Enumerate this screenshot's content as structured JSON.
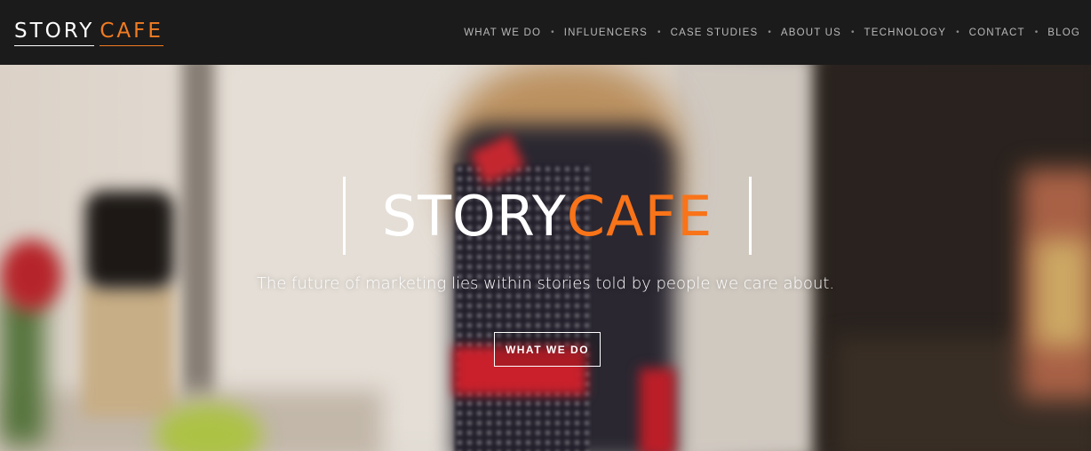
{
  "logo": {
    "story": "STORY",
    "cafe": "CAFE"
  },
  "nav": {
    "items": [
      {
        "label": "WHAT WE DO"
      },
      {
        "label": "INFLUENCERS"
      },
      {
        "label": "CASE STUDIES"
      },
      {
        "label": "ABOUT US"
      },
      {
        "label": "TECHNOLOGY"
      },
      {
        "label": "CONTACT"
      },
      {
        "label": "BLOG"
      }
    ],
    "separator": "•"
  },
  "hero": {
    "title_story": "STORY",
    "title_cafe": "CAFE",
    "tagline": "The future of marketing lies within stories told by people we care about.",
    "cta_label": "WHAT WE DO"
  },
  "colors": {
    "navbar_bg": "#1c1b1b",
    "accent_orange": "#f97318",
    "nav_text": "#b9b9b9",
    "white": "#ffffff"
  }
}
